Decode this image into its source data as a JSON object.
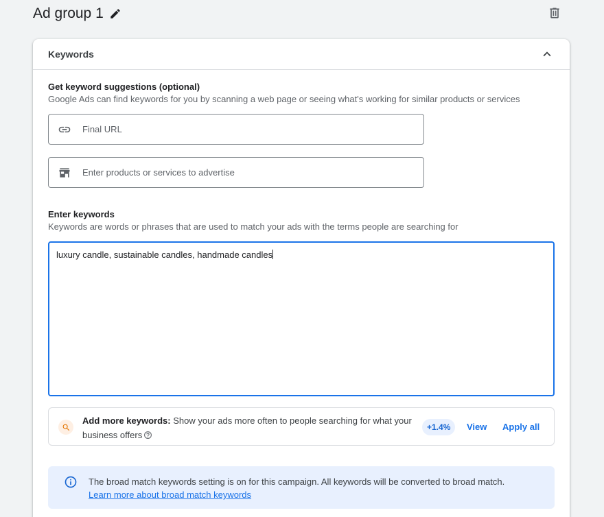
{
  "header": {
    "title": "Ad group 1",
    "edit_icon": "pencil-icon",
    "delete_icon": "trash-icon"
  },
  "card": {
    "title": "Keywords",
    "collapse_icon": "chevron-up-icon"
  },
  "suggestions": {
    "title": "Get keyword suggestions (optional)",
    "description": "Google Ads can find keywords for you by scanning a web page or seeing what's working for similar products or services",
    "url_placeholder": "Final URL",
    "url_icon": "link-icon",
    "products_placeholder": "Enter products or services to advertise",
    "products_icon": "storefront-icon"
  },
  "keywords": {
    "title": "Enter keywords",
    "description": "Keywords are words or phrases that are used to match your ads with the terms people are searching for",
    "value": "luxury candle, sustainable candles, handmade candles"
  },
  "add_more": {
    "label": "Add more keywords:",
    "text_before": " Show your ads more often to people searching for what your business offers",
    "icon": "search-icon",
    "help_icon": "help-circle-icon",
    "percent": "+1.4%",
    "view_label": "View",
    "apply_label": "Apply all"
  },
  "info_banner": {
    "icon": "info-icon",
    "text": "The broad match keywords setting is on for this campaign. All keywords will be converted to broad match.",
    "link": "Learn more about broad match keywords"
  },
  "colors": {
    "accent": "#1a73e8",
    "info_bg": "#e8f0fe",
    "suggest_icon_bg": "#feefe3"
  }
}
